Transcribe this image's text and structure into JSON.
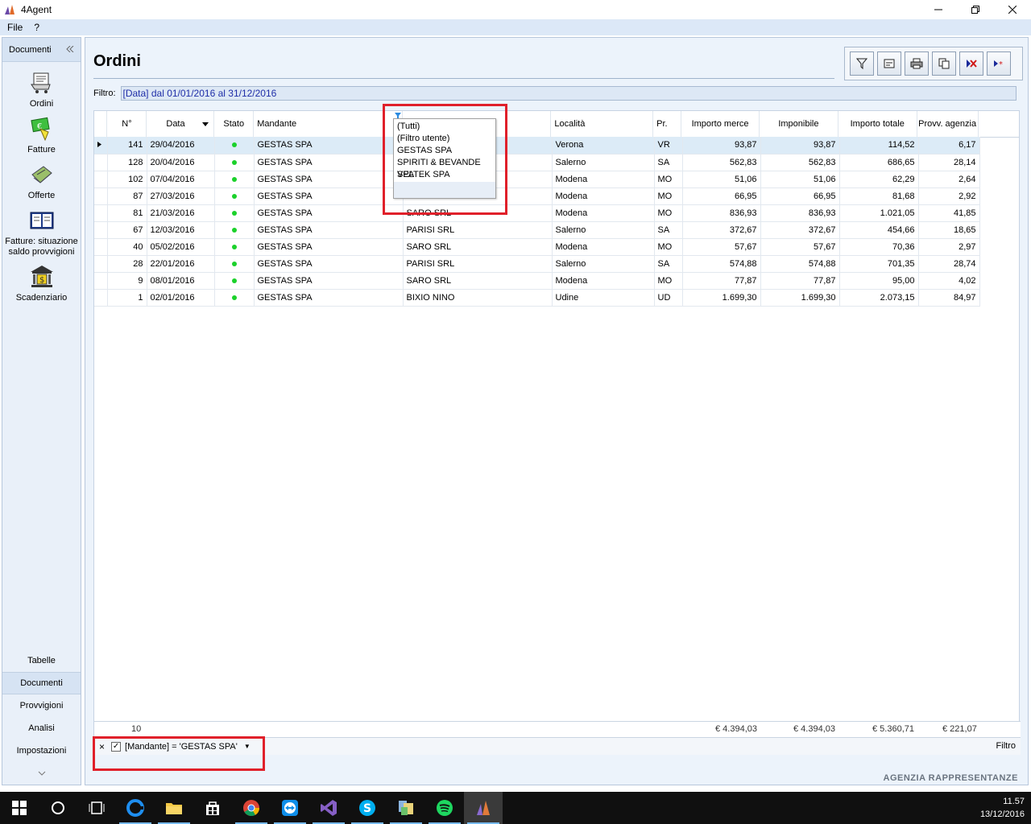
{
  "window": {
    "title": "4Agent"
  },
  "menu": {
    "file": "File",
    "help": "?"
  },
  "left_panel": {
    "header": "Documenti",
    "items": [
      {
        "label": "Ordini"
      },
      {
        "label": "Fatture"
      },
      {
        "label": "Offerte"
      },
      {
        "label": "Fatture: situazione saldo provvigioni"
      },
      {
        "label": "Scadenziario"
      }
    ],
    "categories": [
      "Tabelle",
      "Documenti",
      "Provvigioni",
      "Analisi",
      "Impostazioni"
    ],
    "active_category": "Documenti"
  },
  "main": {
    "title": "Ordini",
    "filter_label": "Filtro:",
    "filter_value": "[Data] dal 01/01/2016 al 31/12/2016"
  },
  "grid": {
    "columns": [
      "N°",
      "Data",
      "Stato",
      "Mandante",
      "",
      "Località",
      "Pr.",
      "Importo merce",
      "Imponibile",
      "Importo totale",
      "Provv. agenzia"
    ],
    "rows": [
      {
        "n": "141",
        "data": "29/04/2016",
        "mandante": "GESTAS SPA",
        "cliente": "",
        "localita": "Verona",
        "pr": "VR",
        "merce": "93,87",
        "imponibile": "93,87",
        "totale": "114,52",
        "provv": "6,17"
      },
      {
        "n": "128",
        "data": "20/04/2016",
        "mandante": "GESTAS SPA",
        "cliente": "",
        "localita": "Salerno",
        "pr": "SA",
        "merce": "562,83",
        "imponibile": "562,83",
        "totale": "686,65",
        "provv": "28,14"
      },
      {
        "n": "102",
        "data": "07/04/2016",
        "mandante": "GESTAS SPA",
        "cliente": "",
        "localita": "Modena",
        "pr": "MO",
        "merce": "51,06",
        "imponibile": "51,06",
        "totale": "62,29",
        "provv": "2,64"
      },
      {
        "n": "87",
        "data": "27/03/2016",
        "mandante": "GESTAS SPA",
        "cliente": "",
        "localita": "Modena",
        "pr": "MO",
        "merce": "66,95",
        "imponibile": "66,95",
        "totale": "81,68",
        "provv": "2,92"
      },
      {
        "n": "81",
        "data": "21/03/2016",
        "mandante": "GESTAS SPA",
        "cliente": "SARO SRL",
        "localita": "Modena",
        "pr": "MO",
        "merce": "836,93",
        "imponibile": "836,93",
        "totale": "1.021,05",
        "provv": "41,85"
      },
      {
        "n": "67",
        "data": "12/03/2016",
        "mandante": "GESTAS SPA",
        "cliente": "PARISI SRL",
        "localita": "Salerno",
        "pr": "SA",
        "merce": "372,67",
        "imponibile": "372,67",
        "totale": "454,66",
        "provv": "18,65"
      },
      {
        "n": "40",
        "data": "05/02/2016",
        "mandante": "GESTAS SPA",
        "cliente": "SARO SRL",
        "localita": "Modena",
        "pr": "MO",
        "merce": "57,67",
        "imponibile": "57,67",
        "totale": "70,36",
        "provv": "2,97"
      },
      {
        "n": "28",
        "data": "22/01/2016",
        "mandante": "GESTAS SPA",
        "cliente": "PARISI SRL",
        "localita": "Salerno",
        "pr": "SA",
        "merce": "574,88",
        "imponibile": "574,88",
        "totale": "701,35",
        "provv": "28,74"
      },
      {
        "n": "9",
        "data": "08/01/2016",
        "mandante": "GESTAS SPA",
        "cliente": "SARO SRL",
        "localita": "Modena",
        "pr": "MO",
        "merce": "77,87",
        "imponibile": "77,87",
        "totale": "95,00",
        "provv": "4,02"
      },
      {
        "n": "1",
        "data": "02/01/2016",
        "mandante": "GESTAS SPA",
        "cliente": "BIXIO NINO",
        "localita": "Udine",
        "pr": "UD",
        "merce": "1.699,30",
        "imponibile": "1.699,30",
        "totale": "2.073,15",
        "provv": "84,97"
      }
    ],
    "totals": {
      "count": "10",
      "merce": "€ 4.394,03",
      "imponibile": "€ 4.394,03",
      "totale": "€ 5.360,71",
      "provv": "€ 221,07"
    }
  },
  "popup": {
    "options": [
      "(Tutti)",
      "(Filtro utente)",
      "GESTAS SPA",
      "SPIRITI & BEVANDE SPA",
      "VELTEK SPA"
    ]
  },
  "filter_bar": {
    "expression": "[Mandante] = 'GESTAS SPA'",
    "right_label": "Filtro"
  },
  "brand": "AGENZIA RAPPRESENTANZE",
  "clock": {
    "time": "11.57",
    "date": "13/12/2016"
  },
  "colors": {
    "status_green": "#1bd12b",
    "highlight_red": "#e0202a",
    "filter_text": "#1f2ea8"
  }
}
